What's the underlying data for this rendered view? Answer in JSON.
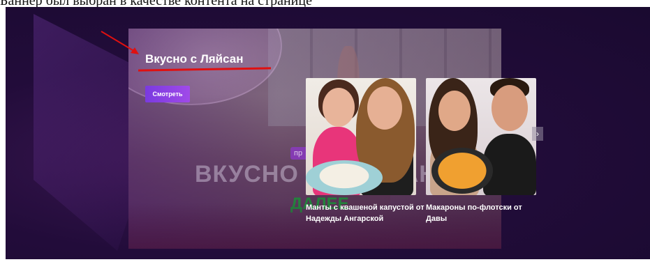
{
  "caption": "Баннер был выбран в качестве контента на странице",
  "banner": {
    "title": "Вкусно с Ляйсан",
    "watch_label": "Смотреть",
    "bg_logo_text": "ВКУСНО С ЛЯЙСАН",
    "bg_badge": "пр",
    "bg_green_text": "ДАЛЕЕ"
  },
  "cards": [
    {
      "title": "Манты с квашеной капустой от Надежды Ангарской"
    },
    {
      "title": "Макароны по-флотски от Давы"
    }
  ],
  "carousel": {
    "next_icon": "›"
  },
  "colors": {
    "accent_purple": "#8a3ae8",
    "annotation_red": "#e01010",
    "page_bg": "#220c3a"
  }
}
